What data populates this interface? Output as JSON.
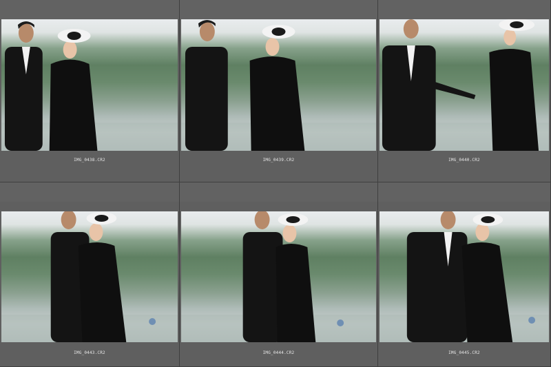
{
  "filmstrip": {
    "thumbnails": [
      {
        "filename": "IMG_0438.CR2"
      },
      {
        "filename": "IMG_0439.CR2"
      },
      {
        "filename": "IMG_0440.CR2"
      },
      {
        "filename": "IMG_0443.CR2"
      },
      {
        "filename": "IMG_0444.CR2"
      },
      {
        "filename": "IMG_0445.CR2"
      }
    ]
  },
  "colors": {
    "cell_background": "#5f5f5f",
    "grid_background": "#4a4a4a",
    "filename_text": "#e8e8e8"
  }
}
